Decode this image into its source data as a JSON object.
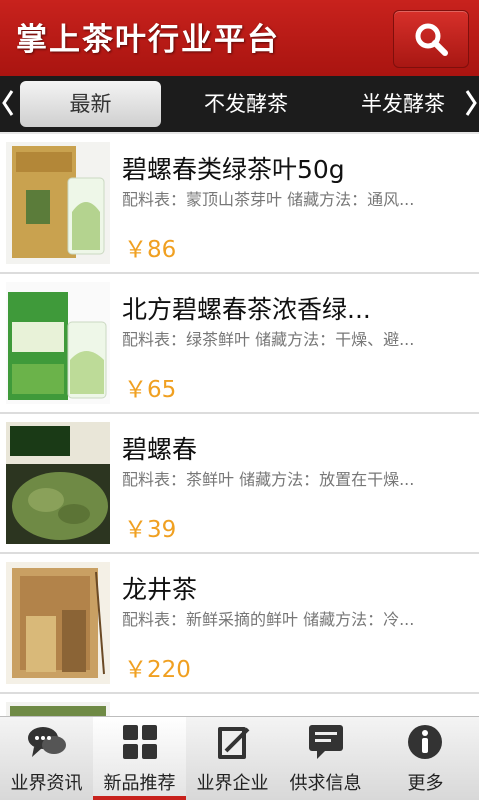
{
  "header": {
    "title": "掌上茶叶行业平台",
    "search_icon": "search-icon"
  },
  "tabs": {
    "items": [
      {
        "label": "最新",
        "active": true
      },
      {
        "label": "不发酵茶",
        "active": false
      },
      {
        "label": "半发酵茶",
        "active": false
      }
    ]
  },
  "products": [
    {
      "title": "碧螺春类绿茶叶50g",
      "desc": "配料表：蒙顶山茶芽叶 储藏方法：通风...",
      "price": "￥86"
    },
    {
      "title": "北方碧螺春茶浓香绿...",
      "desc": "配料表：绿茶鲜叶 储藏方法：干燥、避...",
      "price": "￥65"
    },
    {
      "title": "碧螺春",
      "desc": "配料表：茶鲜叶 储藏方法：放置在干燥...",
      "price": "￥39"
    },
    {
      "title": "龙井茶",
      "desc": "配料表：新鲜采摘的鲜叶 储藏方法：冷...",
      "price": "￥220"
    }
  ],
  "bottom_nav": {
    "items": [
      {
        "label": "业界资讯",
        "icon": "chat-bubbles-icon",
        "active": false
      },
      {
        "label": "新品推荐",
        "icon": "grid-icon",
        "active": true
      },
      {
        "label": "业界企业",
        "icon": "edit-note-icon",
        "active": false
      },
      {
        "label": "供求信息",
        "icon": "message-board-icon",
        "active": false
      },
      {
        "label": "更多",
        "icon": "info-icon",
        "active": false
      }
    ]
  },
  "colors": {
    "brand_red": "#c8221d",
    "price_orange": "#f0a021"
  }
}
